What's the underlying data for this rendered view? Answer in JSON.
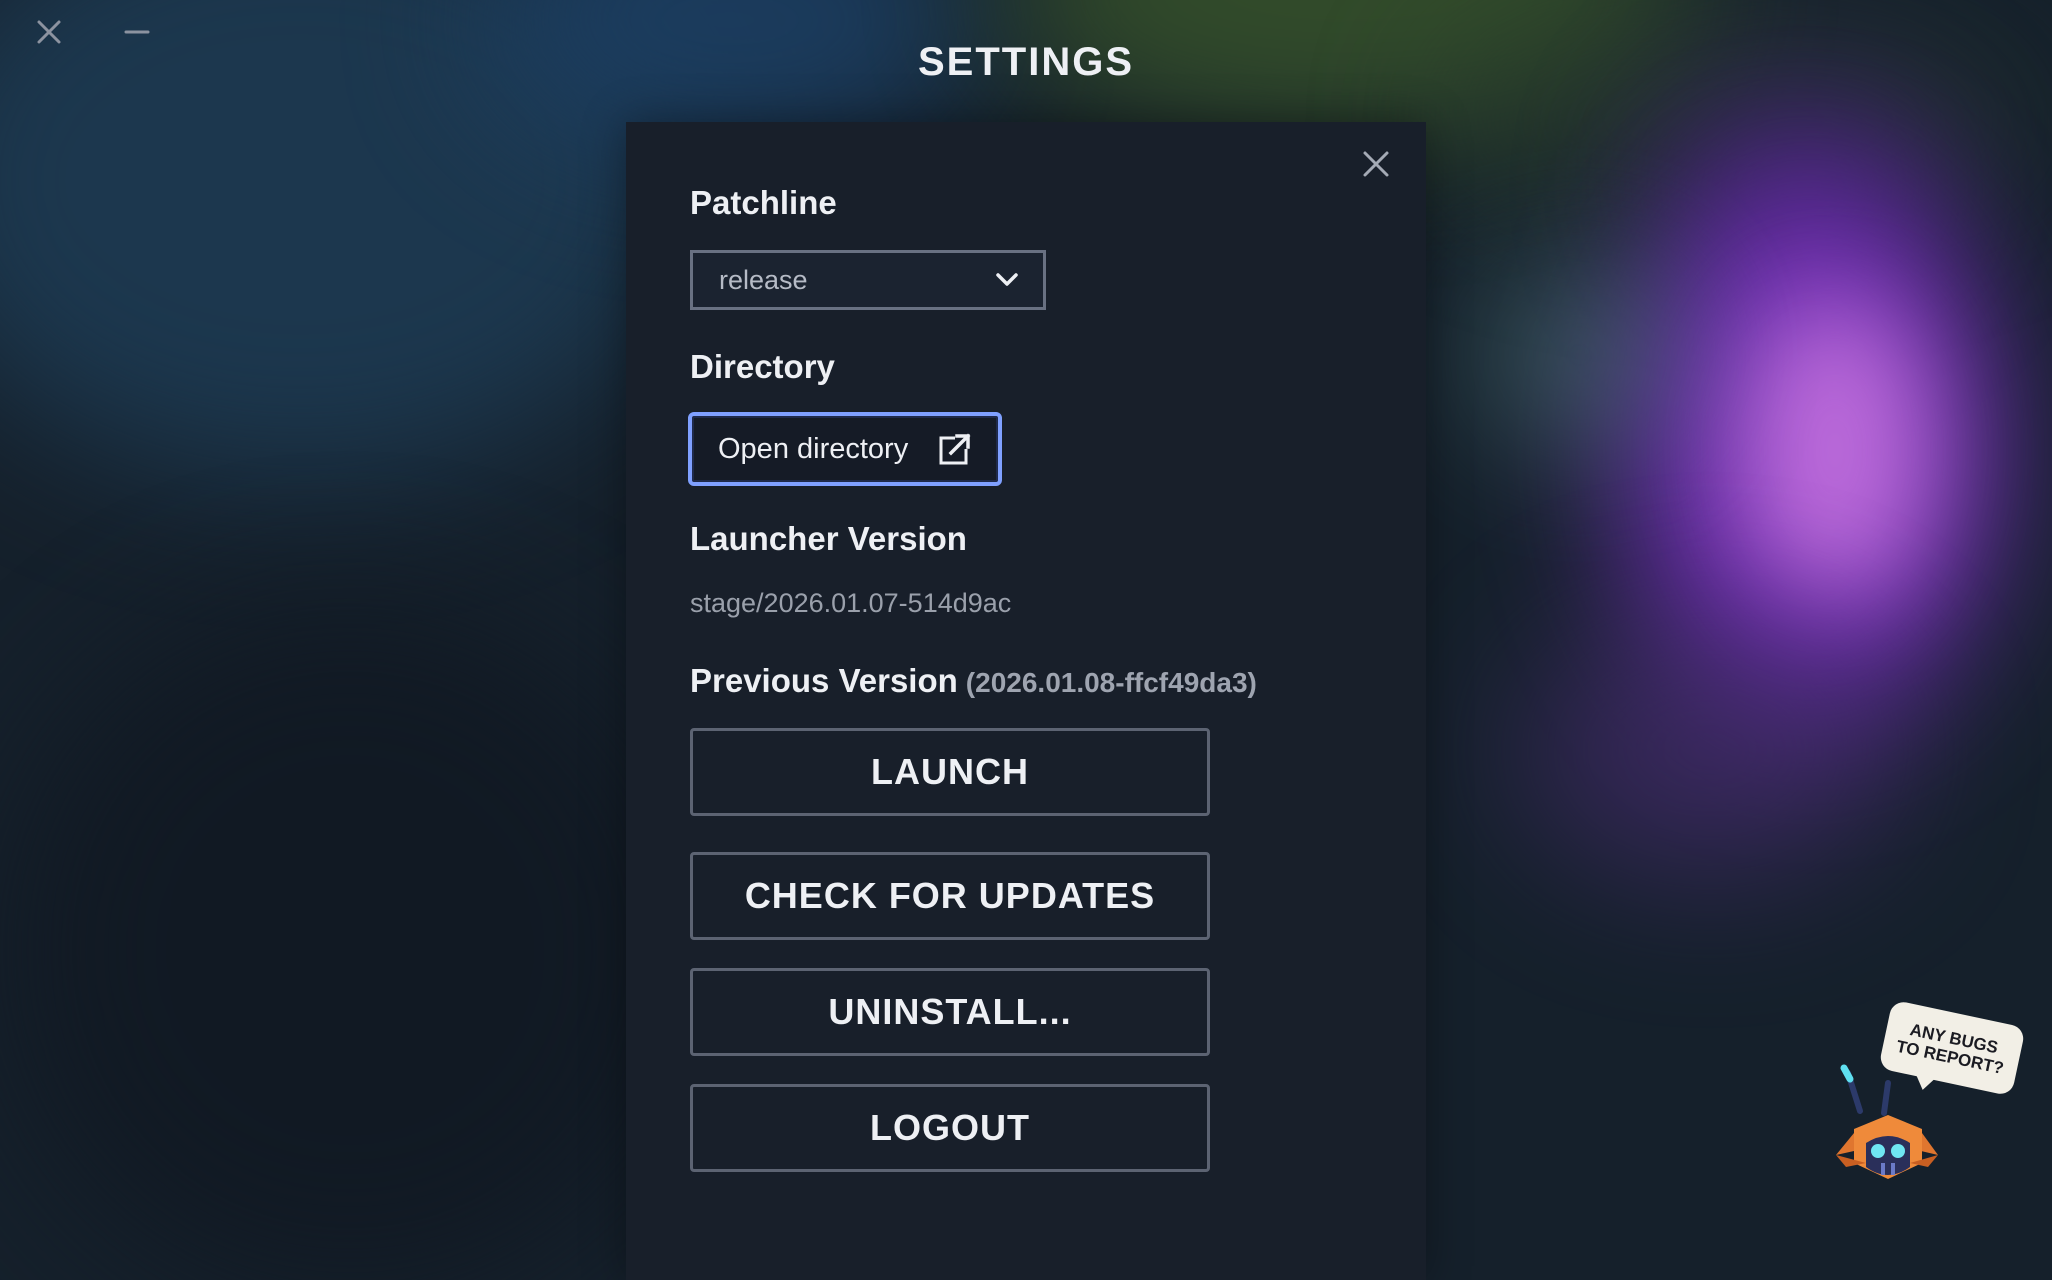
{
  "window": {
    "title": "SETTINGS",
    "close_icon": "close-icon",
    "minimize_icon": "minimize-icon"
  },
  "settings": {
    "patchline": {
      "label": "Patchline",
      "selected": "release"
    },
    "directory": {
      "label": "Directory",
      "button_label": "Open directory",
      "button_icon": "external-link-icon"
    },
    "launcher_version": {
      "label": "Launcher Version",
      "value": "stage/2026.01.07-514d9ac"
    },
    "previous_version": {
      "label": "Previous Version",
      "value": "(2026.01.08-ffcf49da3)"
    },
    "buttons": {
      "launch": "LAUNCH",
      "check_updates": "CHECK FOR UPDATES",
      "uninstall": "UNINSTALL...",
      "logout": "LOGOUT"
    }
  },
  "bug_report": {
    "line1": "ANY BUGS",
    "line2": "TO REPORT?"
  },
  "colors": {
    "panel": "#181f2a",
    "focus_ring": "#7fa0ff",
    "button_border": "#5c6372"
  }
}
